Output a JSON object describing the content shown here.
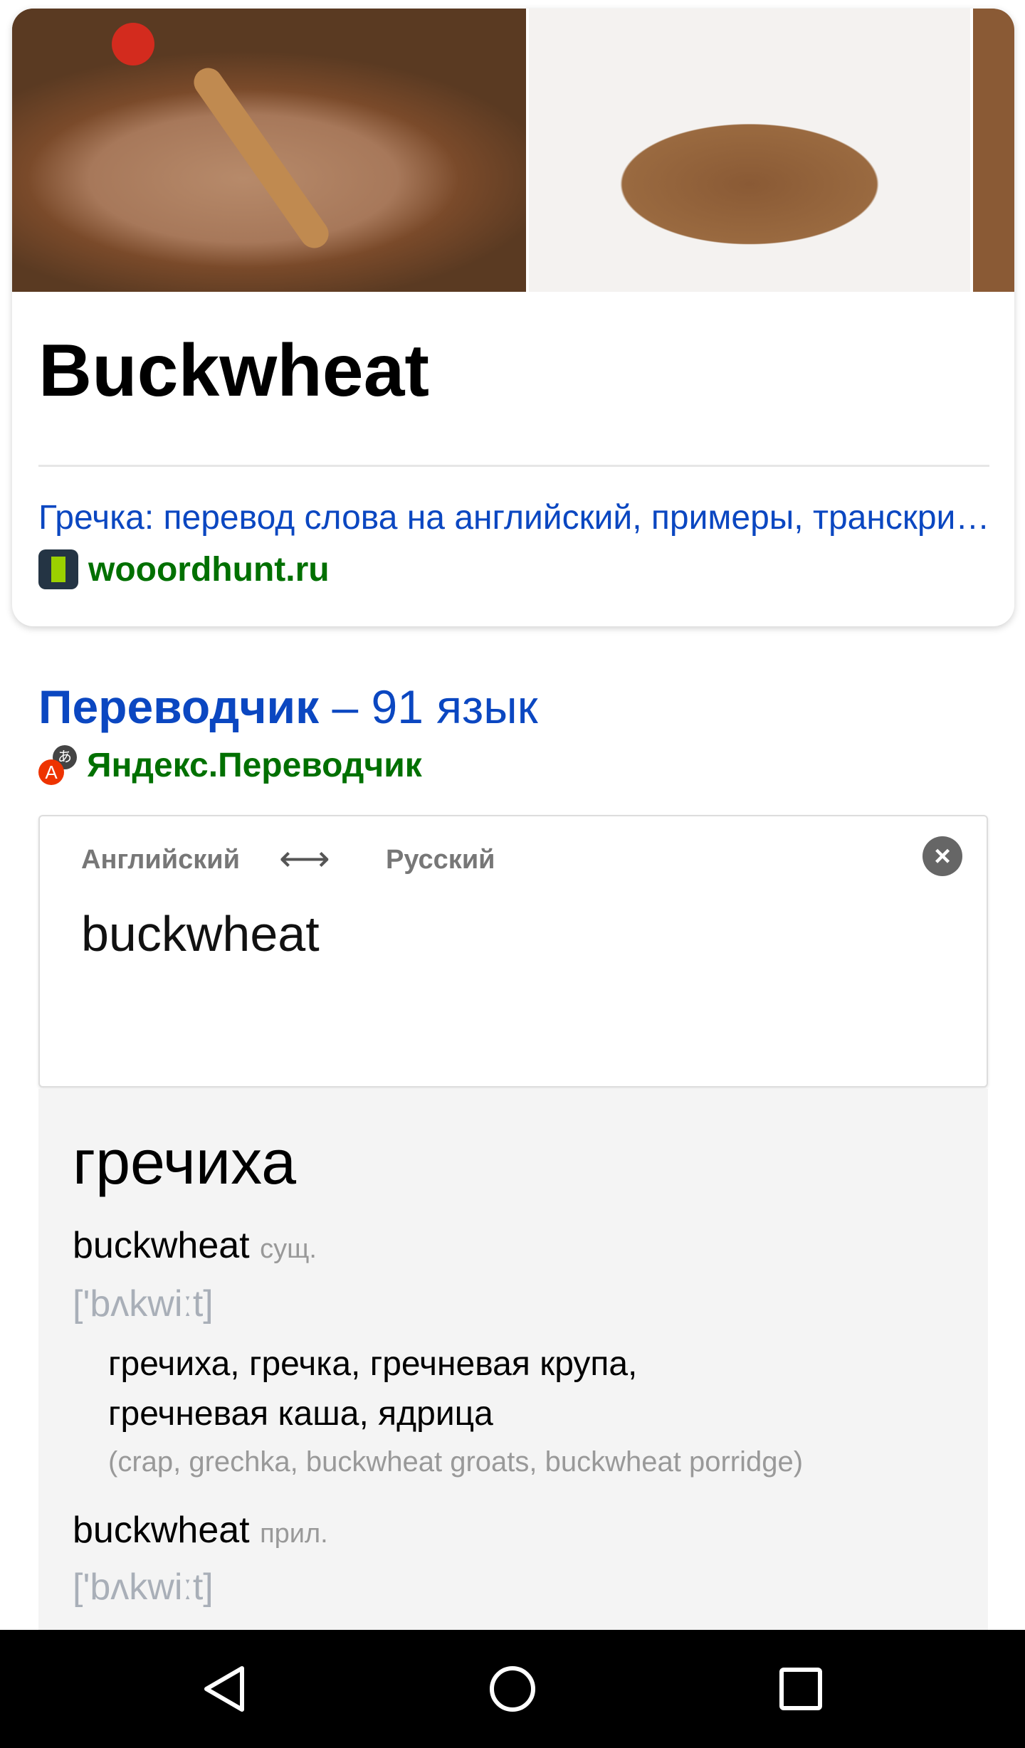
{
  "card": {
    "title": "Buckwheat",
    "link": "Гречка: перевод слова на английский, примеры, транскрипция",
    "site": "wooordhunt.ru",
    "images": [
      "buckwheat-porridge-bowl",
      "buckwheat-grains-pile",
      "buckwheat-grains-closeup"
    ]
  },
  "translator": {
    "title_bold": "Переводчик",
    "title_rest": " – 91 язык",
    "source": "Яндекс.Переводчик",
    "from_lang": "Английский",
    "to_lang": "Русский",
    "input": "buckwheat",
    "main_translation": "гречиха",
    "entries": [
      {
        "word": "buckwheat",
        "pos": "сущ.",
        "pron": "['bʌkwiːt]",
        "trans1": "гречиха, гречка, гречневая крупа,",
        "trans2": "гречневая каша, ядрица",
        "gloss": "(crap, grechka, buckwheat groats, buckwheat porridge)"
      },
      {
        "word": "buckwheat",
        "pos": "прил.",
        "pron": "['bʌkwiːt]"
      }
    ]
  },
  "colors": {
    "link": "#0b47c1",
    "site": "#007000"
  }
}
